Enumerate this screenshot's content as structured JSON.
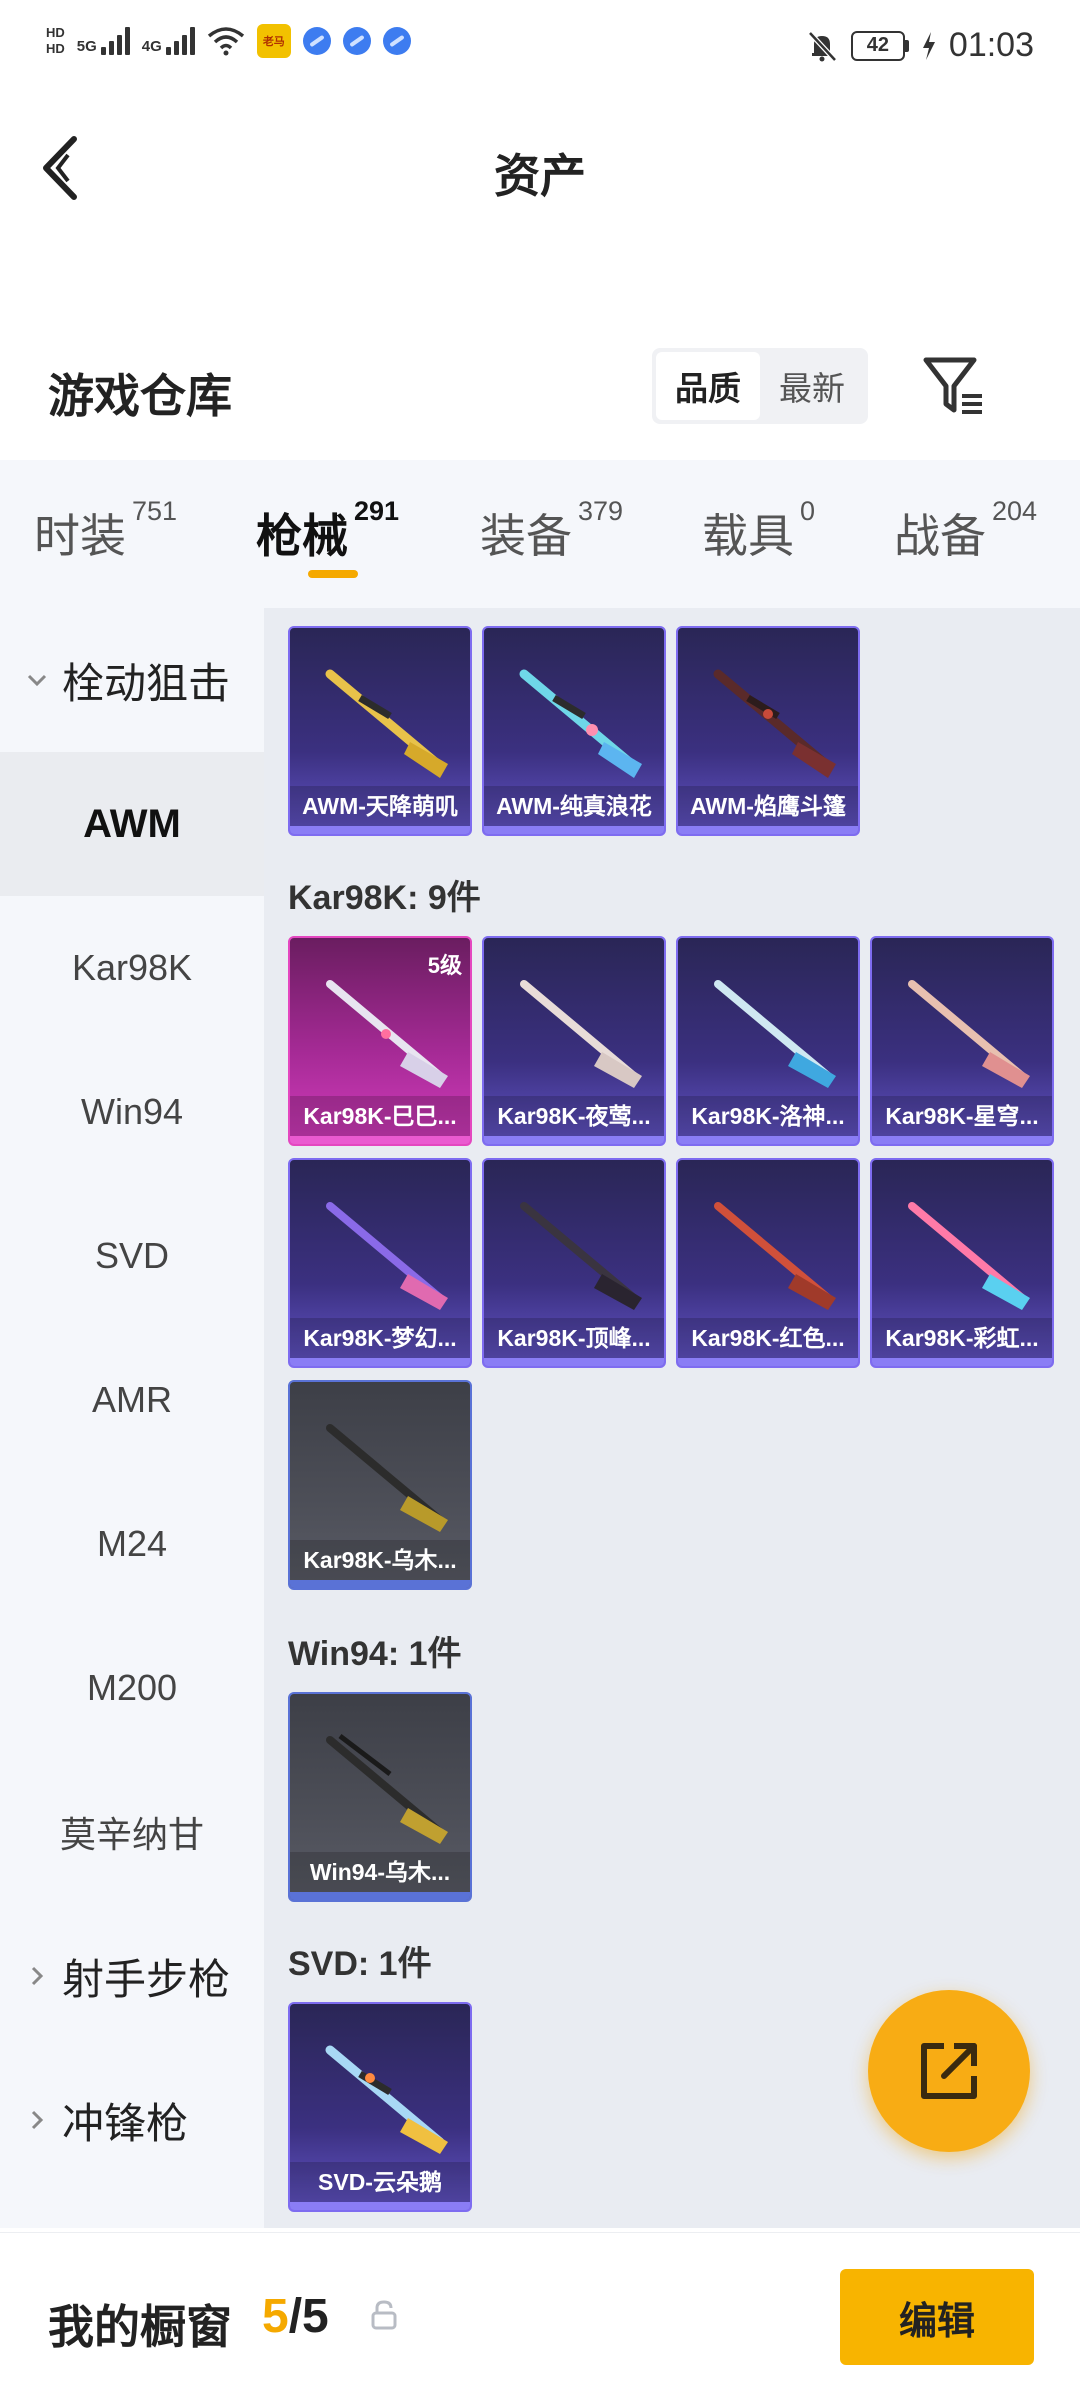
{
  "status_bar": {
    "hd_top": "HD",
    "hd_bottom": "HD",
    "net1": "5G",
    "net2": "4G",
    "app_icon_text": "老马",
    "battery": "42",
    "time": "01:03"
  },
  "header": {
    "title": "资产",
    "back_icon": "chevron-left-icon"
  },
  "warehouse": {
    "title": "游戏仓库",
    "sort_options": [
      "品质",
      "最新"
    ],
    "sort_selected": "品质",
    "filter_icon": "filter-icon"
  },
  "tabs": [
    {
      "label": "时装",
      "count": "751"
    },
    {
      "label": "枪械",
      "count": "291",
      "active": true
    },
    {
      "label": "装备",
      "count": "379"
    },
    {
      "label": "载具",
      "count": "0"
    },
    {
      "label": "战备",
      "count": "204"
    }
  ],
  "sidebar": {
    "group_open": "栓动狙击",
    "items": [
      "AWM",
      "Kar98K",
      "Win94",
      "SVD",
      "AMR",
      "M24",
      "M200",
      "莫辛纳甘"
    ],
    "active_item": "AWM",
    "groups_closed": [
      "射手步枪",
      "冲锋枪"
    ]
  },
  "content": {
    "awm_cards": [
      {
        "name": "AWM-天降萌叽"
      },
      {
        "name": "AWM-纯真浪花"
      },
      {
        "name": "AWM-焰鹰斗篷"
      }
    ],
    "kar98k_label": "Kar98K: 9件",
    "kar98k_cards": [
      {
        "name": "Kar98K-巳巳...",
        "level": "5级"
      },
      {
        "name": "Kar98K-夜莺..."
      },
      {
        "name": "Kar98K-洛神..."
      },
      {
        "name": "Kar98K-星穹..."
      },
      {
        "name": "Kar98K-梦幻..."
      },
      {
        "name": "Kar98K-顶峰..."
      },
      {
        "name": "Kar98K-红色..."
      },
      {
        "name": "Kar98K-彩虹..."
      },
      {
        "name": "Kar98K-乌木..."
      }
    ],
    "win94_label": "Win94: 1件",
    "win94_cards": [
      {
        "name": "Win94-乌木..."
      }
    ],
    "svd_label": "SVD: 1件",
    "svd_cards": [
      {
        "name": "SVD-云朵鹅"
      }
    ]
  },
  "fab": {
    "icon": "share-icon"
  },
  "showcase": {
    "title": "我的橱窗",
    "count_current": "5",
    "count_sep": "/",
    "count_max": "5",
    "lock_icon": "lock-icon",
    "edit_label": "编辑"
  }
}
